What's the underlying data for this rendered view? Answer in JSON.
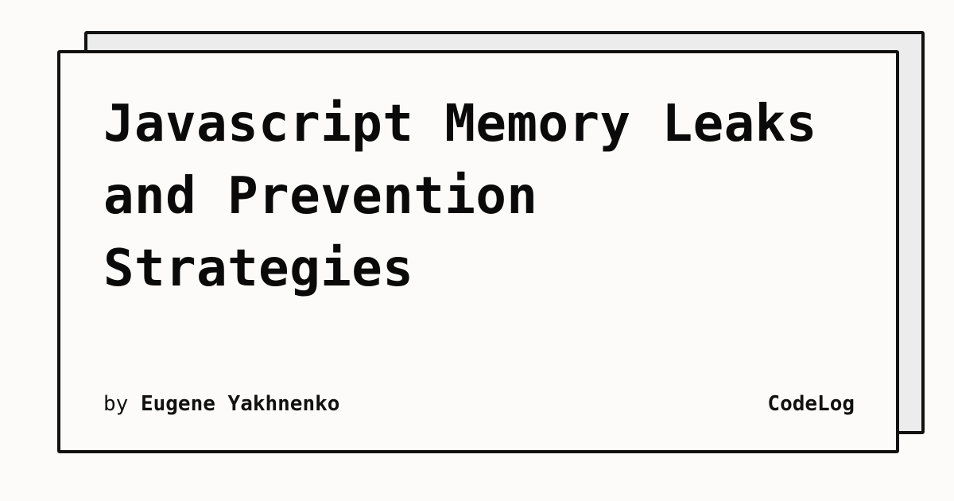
{
  "card": {
    "title": "Javascript Memory Leaks and Prevention Strategies",
    "byline_prefix": "by",
    "author": "Eugene Yakhnenko",
    "site_name": "CodeLog"
  },
  "colors": {
    "background": "#fcfbf9",
    "back_card": "#ececec",
    "border": "#111111",
    "text": "#0a0a0a"
  }
}
